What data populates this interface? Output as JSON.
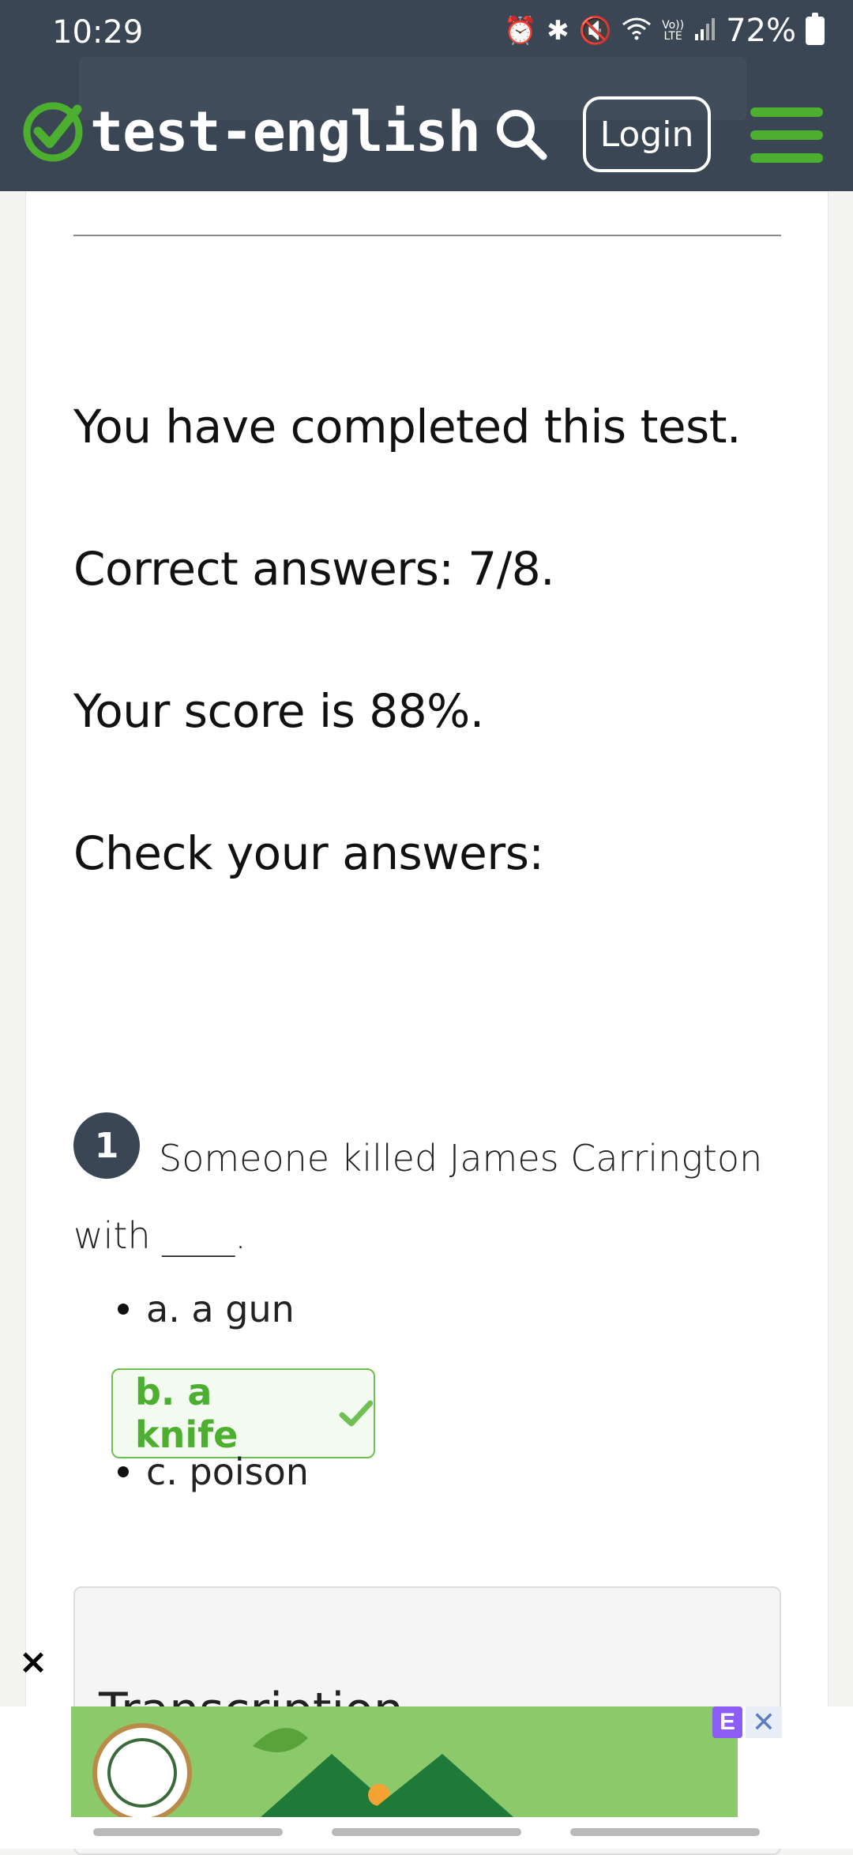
{
  "status_bar": {
    "time": "10:29",
    "icons": [
      "alarm-icon",
      "bluetooth-icon",
      "mute-icon",
      "wifi-icon",
      "volte-icon",
      "signal-icon"
    ],
    "volte_label": "Vo)) LTE",
    "battery": "72%"
  },
  "header": {
    "logo_text": "test-english",
    "login_label": "Login",
    "brand_color": "#4caf2f",
    "bg_color": "#3b4654"
  },
  "results": {
    "completed": "You have completed this test.",
    "correct": "Correct answers: 7/8.",
    "score": "Your score is 88%.",
    "check": "Check your answers:"
  },
  "question": {
    "number": "1",
    "text": "Someone killed James Carrington with ____.",
    "options": [
      {
        "label": "a. a gun",
        "correct": false
      },
      {
        "label": "b. a knife",
        "correct": true
      },
      {
        "label": "c. poison",
        "correct": false
      }
    ]
  },
  "transcription": {
    "title": "Transcription"
  },
  "ad": {
    "close_label": "×",
    "badge": "E",
    "dismiss": "✕"
  }
}
